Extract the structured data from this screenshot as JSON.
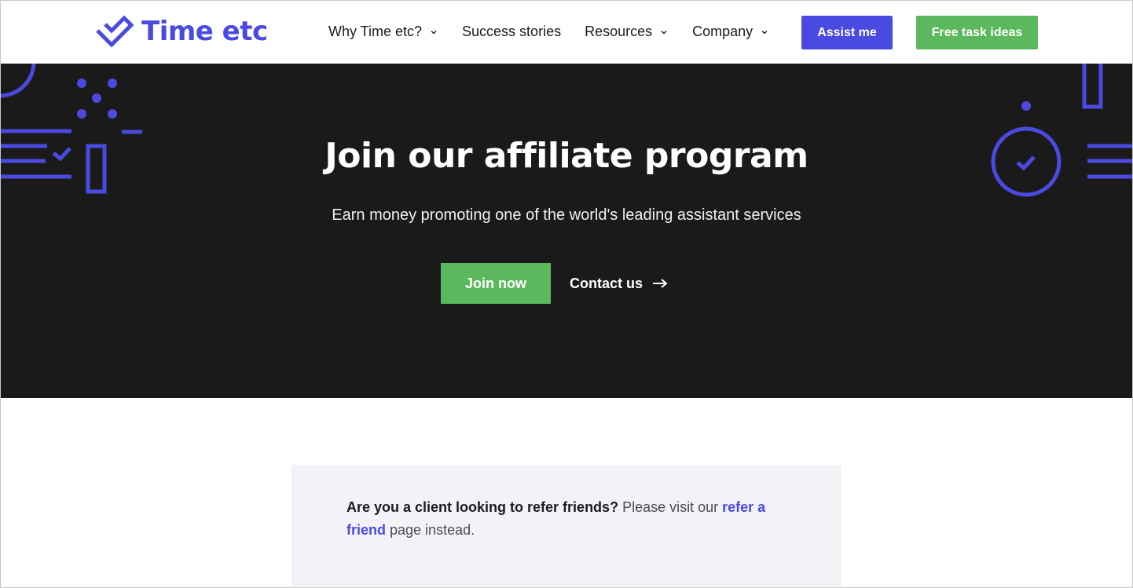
{
  "brand": {
    "name": "Time etc",
    "accent": "#4a4ae0",
    "green": "#5cb85c",
    "hero_bg": "#1a1a1b"
  },
  "nav": {
    "items": [
      {
        "label": "Why Time etc?",
        "has_dropdown": true
      },
      {
        "label": "Success stories",
        "has_dropdown": false
      },
      {
        "label": "Resources",
        "has_dropdown": true
      },
      {
        "label": "Company",
        "has_dropdown": true
      }
    ],
    "assist_label": "Assist me",
    "ideas_label": "Free task ideas"
  },
  "hero": {
    "title": "Join our affiliate program",
    "subtitle": "Earn money promoting one of the world's leading assistant services",
    "join_label": "Join now",
    "contact_label": "Contact us"
  },
  "notice": {
    "question": "Are you a client looking to refer friends?",
    "text_before": " Please visit our ",
    "link_label": "refer a friend",
    "text_after": " page instead."
  }
}
